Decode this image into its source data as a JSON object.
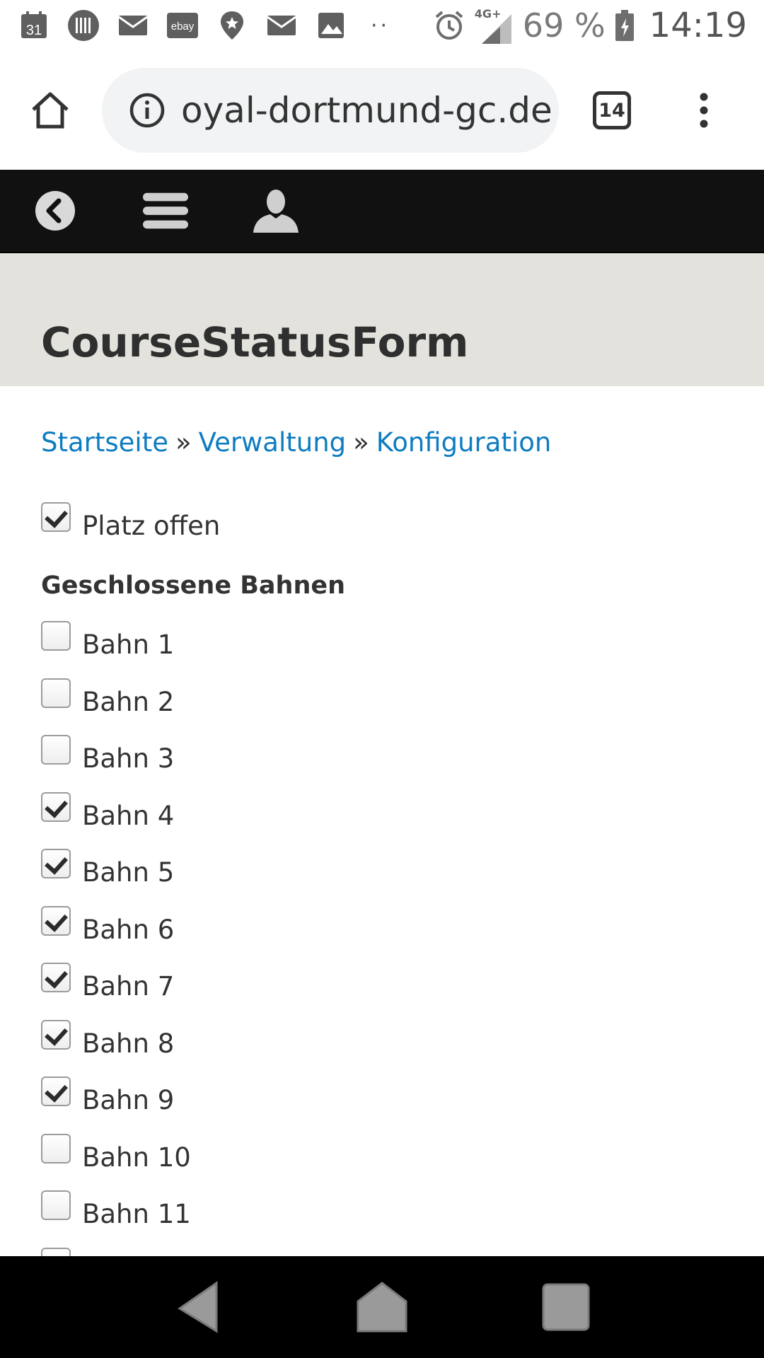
{
  "status_bar": {
    "icons": [
      "calendar-icon",
      "barcode-icon",
      "mail-icon",
      "ebay-icon",
      "location-pin-icon",
      "mail-icon",
      "image-icon"
    ],
    "calendar_day": "31",
    "ebay_text": "ebay",
    "more_dots": "··",
    "network": "4G+",
    "battery_percent": "69 %",
    "time": "14:19"
  },
  "browser": {
    "url": "oyal-dortmund-gc.de",
    "tab_count": "14"
  },
  "page": {
    "title": "CourseStatusForm",
    "breadcrumb": [
      {
        "label": "Startseite"
      },
      {
        "label": "Verwaltung"
      },
      {
        "label": "Konfiguration"
      }
    ],
    "breadcrumb_separator": "»",
    "course_open": {
      "label": "Platz offen",
      "checked": true
    },
    "closed_holes_label": "Geschlossene Bahnen",
    "holes": [
      {
        "label": "Bahn 1",
        "checked": false
      },
      {
        "label": "Bahn 2",
        "checked": false
      },
      {
        "label": "Bahn 3",
        "checked": false
      },
      {
        "label": "Bahn 4",
        "checked": true
      },
      {
        "label": "Bahn 5",
        "checked": true
      },
      {
        "label": "Bahn 6",
        "checked": true
      },
      {
        "label": "Bahn 7",
        "checked": true
      },
      {
        "label": "Bahn 8",
        "checked": true
      },
      {
        "label": "Bahn 9",
        "checked": true
      },
      {
        "label": "Bahn 10",
        "checked": false
      },
      {
        "label": "Bahn 11",
        "checked": false
      }
    ]
  },
  "colors": {
    "link": "#0e7cc1",
    "navbar_bg": "#111111",
    "title_band_bg": "#e3e2dc"
  }
}
